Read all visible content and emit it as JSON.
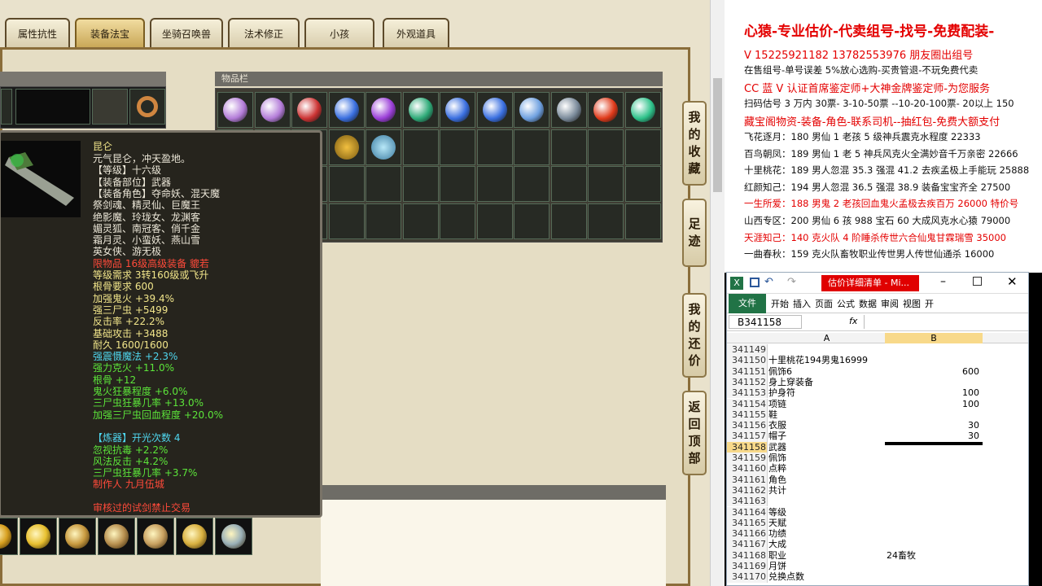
{
  "game": {
    "tabs": [
      "属性抗性",
      "装备法宝",
      "坐骑召唤兽",
      "法术修正",
      "小孩",
      "外观道具"
    ],
    "active_tab": 1,
    "inventory_header": "物品栏",
    "side_buttons": [
      "我的收藏",
      "足迹",
      "我的还价",
      "返回顶部"
    ],
    "tooltip": {
      "name": "昆仑",
      "lines": [
        {
          "t": "元气昆仑，冲天盈地。",
          "c": "w"
        },
        {
          "t": "【等级】十六级",
          "c": "w"
        },
        {
          "t": "【装备部位】武器",
          "c": "w"
        },
        {
          "t": "【装备角色】夺命妖、混天魔",
          "c": "w"
        },
        {
          "t": "祭剑魂、精灵仙、巨魔王",
          "c": "w"
        },
        {
          "t": "绝影魔、玲珑女、龙渊客",
          "c": "w"
        },
        {
          "t": "媚灵狐、南冠客、俏千金",
          "c": "w"
        },
        {
          "t": "霜月灵、小蛮妖、燕山雪",
          "c": "w"
        },
        {
          "t": "英女侠、游无极",
          "c": "w"
        },
        {
          "t": "限物品 16级高级装备 貔若",
          "c": "r"
        },
        {
          "t": "等级需求 3转160级或飞升",
          "c": "y"
        },
        {
          "t": "根骨要求 600",
          "c": "y"
        },
        {
          "t": "加强鬼火 +39.4%",
          "c": "y"
        },
        {
          "t": "强三尸虫 +5499",
          "c": "y"
        },
        {
          "t": "反击率 +22.2%",
          "c": "y"
        },
        {
          "t": "基础攻击 +3488",
          "c": "y"
        },
        {
          "t": "耐久 1600/1600",
          "c": "y"
        },
        {
          "t": "强震慑魔法 +2.3%",
          "c": "c"
        },
        {
          "t": "强力克火 +11.0%",
          "c": "g"
        },
        {
          "t": "根骨 +12",
          "c": "g"
        },
        {
          "t": "鬼火狂暴程度 +6.0%",
          "c": "g"
        },
        {
          "t": "三尸虫狂暴几率 +13.0%",
          "c": "g"
        },
        {
          "t": "加强三尸虫回血程度 +20.0%",
          "c": "g"
        },
        {
          "t": "",
          "c": "w"
        },
        {
          "t": "【炼器】开光次数 4",
          "c": "c"
        },
        {
          "t": "忽视抗毒 +2.2%",
          "c": "g"
        },
        {
          "t": "风法反击 +4.2%",
          "c": "g"
        },
        {
          "t": "三尸虫狂暴几率 +3.7%",
          "c": "g"
        },
        {
          "t": "制作人 九月伍城",
          "c": "r"
        },
        {
          "t": "",
          "c": "w"
        },
        {
          "t": "审核过的试剑禁止交易",
          "c": "r"
        }
      ]
    }
  },
  "info": {
    "title": "心猿-专业估价-代卖组号-找号-免费配装-",
    "lines": [
      {
        "t": "V 15225921182   13782553976 朋友圈出组号",
        "c": "red"
      },
      {
        "t": "在售组号-单号误差 5%放心选购-买贵管退-不玩免费代卖",
        "c": ""
      },
      {
        "t": "CC 蓝 V 认证首席鉴定师+大神金牌鉴定师-为您服务",
        "c": "red"
      },
      {
        "t": "扫码估号 3 万内 30票- 3-10-50票  --10-20-100票- 20以上 150",
        "c": ""
      },
      {
        "t": "藏宝阁物资-装备-角色-联系司机--抽红包-免费大额支付",
        "c": "red"
      },
      {
        "t": "飞花逐月：180 男仙 1 老孩 5 级神兵震克水程度 22333",
        "c": ""
      },
      {
        "t": "百鸟朝凤：189 男仙 1 老 5 神兵风克火全满妙音千万亲密 22666",
        "c": ""
      },
      {
        "t": "十里桃花：189 男人忽混 35.3 强混 41.2 去疾孟极上手能玩 25888",
        "c": ""
      },
      {
        "t": "红颜知己：194 男人忽混 36.5 强混 38.9 装备宝宝齐全 27500",
        "c": ""
      },
      {
        "t": "一生所爱：188 男鬼 2 老孩回血鬼火孟极去疾百万 26000 特价号",
        "c": "red"
      },
      {
        "t": "山西专区：200 男仙 6 孩 988 宝石 60 大成风克水心猿 79000",
        "c": ""
      },
      {
        "t": "天涯知己：140 克火队 4 阶睡杀传世六合仙鬼甘霖瑞雪 35000",
        "c": "red"
      },
      {
        "t": "一曲春秋：159 克火队畜牧职业传世男人传世仙通杀 16000",
        "c": ""
      }
    ]
  },
  "excel": {
    "title": "估价详细清单 - Mi...",
    "ribbon_tabs": [
      "文件",
      "开始",
      "插入",
      "页面",
      "公式",
      "数据",
      "审阅",
      "视图",
      "开"
    ],
    "name_box": "B341158",
    "fx": "fx",
    "columns": [
      "A",
      "B"
    ],
    "rows": [
      {
        "n": "341149",
        "a": "",
        "b": ""
      },
      {
        "n": "341150",
        "a": "十里桃花194男鬼16999",
        "b": ""
      },
      {
        "n": "341151",
        "a": "佩饰6",
        "b": "600"
      },
      {
        "n": "341152",
        "a": "身上穿装备",
        "b": ""
      },
      {
        "n": "341153",
        "a": "护身符",
        "b": "100"
      },
      {
        "n": "341154",
        "a": "项链",
        "b": "100"
      },
      {
        "n": "341155",
        "a": "鞋",
        "b": ""
      },
      {
        "n": "341156",
        "a": "衣服",
        "b": "30"
      },
      {
        "n": "341157",
        "a": "帽子",
        "b": "30"
      },
      {
        "n": "341158",
        "a": "武器",
        "b": ""
      },
      {
        "n": "341159",
        "a": "佩饰",
        "b": ""
      },
      {
        "n": "341160",
        "a": "点粹",
        "b": ""
      },
      {
        "n": "341161",
        "a": "角色",
        "b": ""
      },
      {
        "n": "341162",
        "a": "共计",
        "b": ""
      },
      {
        "n": "341163",
        "a": "",
        "b": ""
      },
      {
        "n": "341164",
        "a": "等级",
        "b": ""
      },
      {
        "n": "341165",
        "a": "天赋",
        "b": ""
      },
      {
        "n": "341166",
        "a": "功绩",
        "b": ""
      },
      {
        "n": "341167",
        "a": "大成",
        "b": ""
      },
      {
        "n": "341168",
        "a": "职业",
        "b": "24畜牧"
      },
      {
        "n": "341169",
        "a": "月饼",
        "b": ""
      },
      {
        "n": "341170",
        "a": "兑换点数",
        "b": ""
      }
    ],
    "selected_row": "341158"
  },
  "colors": {
    "red": "#e40000",
    "excel_green": "#217346",
    "selection": "#f8d98a"
  }
}
